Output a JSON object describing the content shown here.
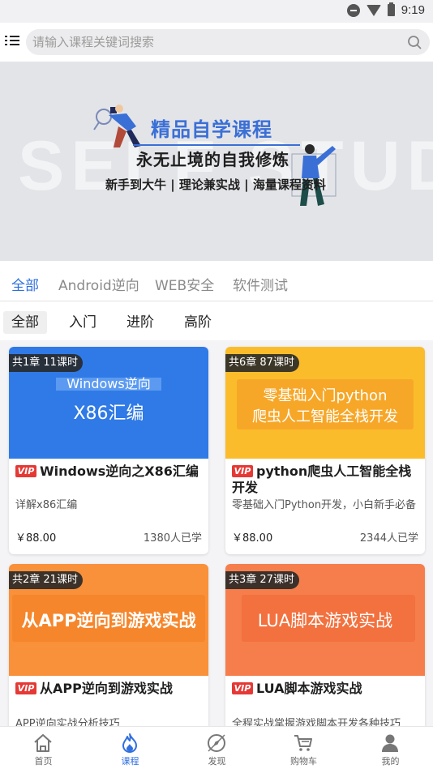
{
  "status_bar": {
    "time": "9:19"
  },
  "search": {
    "placeholder": "请输入课程关键词搜索"
  },
  "banner": {
    "watermark": "SELF STUDY",
    "title": "精品自学课程",
    "subtitle": "永无止境的自我修炼",
    "tagline": "新手到大牛 | 理论兼实战 | 海量课程资料"
  },
  "category_tabs": [
    "全部",
    "Android逆向",
    "WEB安全",
    "软件测试"
  ],
  "level_tabs": [
    "全部",
    "入门",
    "进阶",
    "高阶"
  ],
  "courses": [
    {
      "chapters": "共1章 11课时",
      "thumb_line1": "Windows逆向",
      "thumb_line2": "X86汇编",
      "vip": "VIP",
      "title": "Windows逆向之X86汇编",
      "desc": "详解x86汇编",
      "price": "￥88.00",
      "learners": "1380人已学",
      "thumb_color": "#2f7ae6"
    },
    {
      "chapters": "共6章 87课时",
      "thumb_line1": "零基础入门python",
      "thumb_line2": "爬虫人工智能全栈开发",
      "vip": "VIP",
      "title": "python爬虫人工智能全栈开发",
      "desc": "零基础入门Python开发，小白新手必备",
      "price": "￥88.00",
      "learners": "2344人已学",
      "thumb_color": "#fbbc2c"
    },
    {
      "chapters": "共2章 21课时",
      "thumb_line1": "从APP逆向到游戏实战",
      "vip": "VIP",
      "title": "从APP逆向到游戏实战",
      "desc": "APP逆向实战分析技巧",
      "thumb_color": "#f9903a"
    },
    {
      "chapters": "共3章 27课时",
      "thumb_line1": "LUA脚本游戏实战",
      "vip": "VIP",
      "title": "LUA脚本游戏实战",
      "desc": "全程实战掌握游戏脚本开发各种技巧",
      "thumb_color": "#f57e4c"
    }
  ],
  "tabbar": [
    {
      "label": "首页",
      "icon": "home-icon"
    },
    {
      "label": "课程",
      "icon": "flame-icon"
    },
    {
      "label": "发现",
      "icon": "compass-icon"
    },
    {
      "label": "购物车",
      "icon": "cart-icon"
    },
    {
      "label": "我的",
      "icon": "user-icon"
    }
  ],
  "colors": {
    "accent": "#2f6fe0",
    "vip": "#e53935"
  }
}
